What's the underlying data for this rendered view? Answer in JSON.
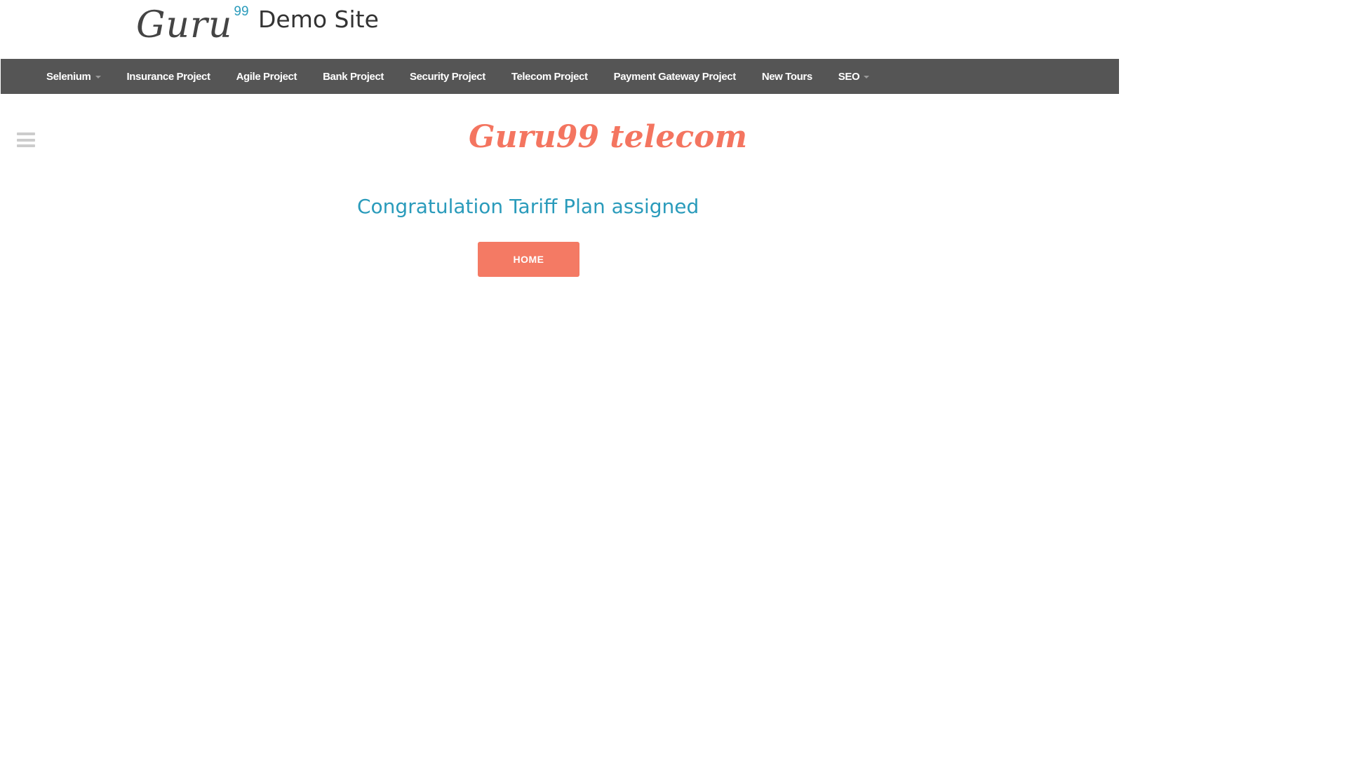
{
  "header": {
    "logo_text": "Guru",
    "logo_superscript": "99",
    "site_title": "Demo Site"
  },
  "nav": {
    "items": [
      {
        "label": "Selenium",
        "has_dropdown": true
      },
      {
        "label": "Insurance Project",
        "has_dropdown": false
      },
      {
        "label": "Agile Project",
        "has_dropdown": false
      },
      {
        "label": "Bank Project",
        "has_dropdown": false
      },
      {
        "label": "Security Project",
        "has_dropdown": false
      },
      {
        "label": "Telecom Project",
        "has_dropdown": false
      },
      {
        "label": "Payment Gateway Project",
        "has_dropdown": false
      },
      {
        "label": "New Tours",
        "has_dropdown": false
      },
      {
        "label": "SEO",
        "has_dropdown": true
      }
    ]
  },
  "sidebar_toggle": {
    "icon": "hamburger-menu-icon"
  },
  "main": {
    "brand_heading": "Guru99 telecom",
    "message": "Congratulation Tariff Plan assigned",
    "home_button_label": "HOME"
  },
  "colors": {
    "navbar_bg": "#555555",
    "accent_coral": "#f47a64",
    "accent_teal": "#2a9bbb"
  }
}
